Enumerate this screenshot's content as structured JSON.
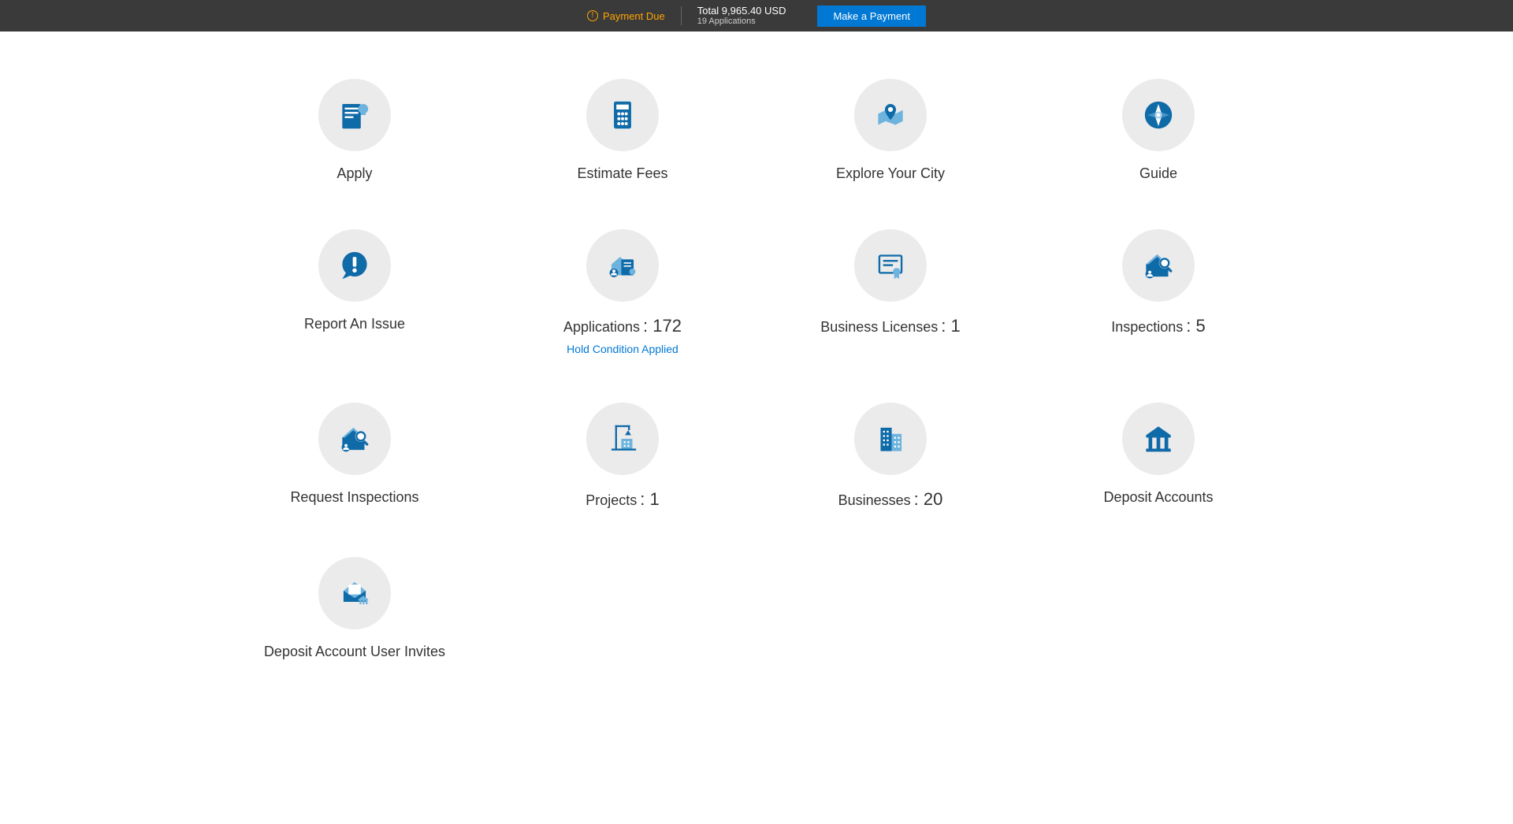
{
  "topbar": {
    "payment_due_label": "Payment Due",
    "total_label": "Total 9,965.40 USD",
    "app_count_label": "19 Applications",
    "make_payment_label": "Make a Payment"
  },
  "tiles": {
    "apply": {
      "label": "Apply"
    },
    "estimate": {
      "label": "Estimate Fees"
    },
    "explore": {
      "label": "Explore Your City"
    },
    "guide": {
      "label": "Guide"
    },
    "report": {
      "label": "Report An Issue"
    },
    "applications": {
      "label": "Applications",
      "count": "172",
      "sublink": "Hold Condition Applied"
    },
    "business_licenses": {
      "label": "Business Licenses",
      "count": "1"
    },
    "inspections": {
      "label": "Inspections",
      "count": "5"
    },
    "request_inspections": {
      "label": "Request Inspections"
    },
    "projects": {
      "label": "Projects",
      "count": "1"
    },
    "businesses": {
      "label": "Businesses",
      "count": "20"
    },
    "deposit_accounts": {
      "label": "Deposit Accounts"
    },
    "deposit_invites": {
      "label": "Deposit Account User Invites"
    }
  }
}
